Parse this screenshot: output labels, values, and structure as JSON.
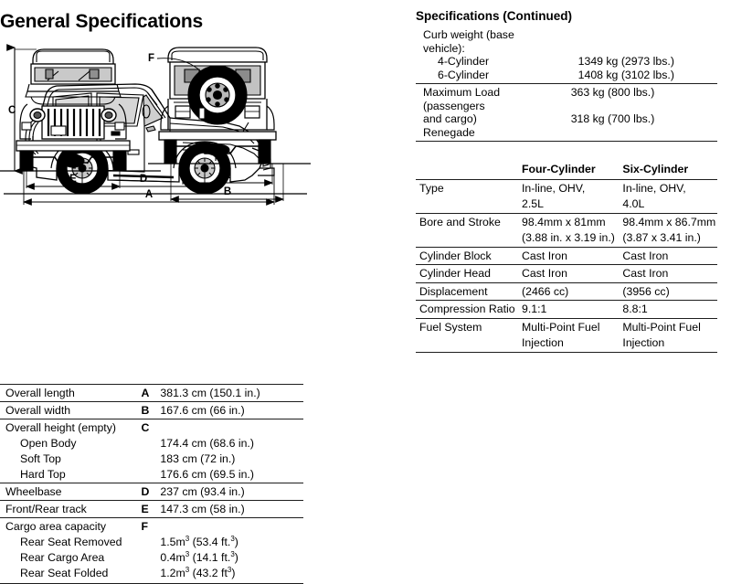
{
  "page": {
    "title": "General Specifications"
  },
  "illustration": {
    "views": [
      {
        "name": "side-view",
        "vehicle": "Jeep Wrangler YJ side profile"
      },
      {
        "name": "front-view",
        "vehicle": "Jeep Wrangler YJ front elevation"
      },
      {
        "name": "rear-view",
        "vehicle": "Jeep Wrangler YJ rear elevation with spare tire"
      }
    ],
    "dimension_callouts": [
      {
        "key": "A",
        "view": "side-view",
        "meaning": "Overall length"
      },
      {
        "key": "D",
        "view": "side-view",
        "meaning": "Wheelbase"
      },
      {
        "key": "C",
        "view": "front-view",
        "meaning": "Overall height"
      },
      {
        "key": "E",
        "view": "front-view",
        "meaning": "Front track"
      },
      {
        "key": "E",
        "view": "rear-view",
        "meaning": "Rear track"
      },
      {
        "key": "B",
        "view": "rear-view",
        "meaning": "Overall width"
      },
      {
        "key": "F",
        "view": "rear-view",
        "meaning": "Cargo area capacity"
      }
    ],
    "labels": {
      "A": "A",
      "B": "B",
      "C": "C",
      "D": "D",
      "E": "E",
      "F": "F"
    }
  },
  "specs_continued": {
    "title": "Specifications (Continued)",
    "weight_rows": [
      {
        "label": "Curb weight (base",
        "value": "",
        "indent": false
      },
      {
        "label": "vehicle):",
        "value": "",
        "indent": false
      },
      {
        "label": "4-Cylinder",
        "value": "1349 kg (2973 lbs.)",
        "indent": true
      },
      {
        "label": "6-Cylinder",
        "value": "1408 kg (3102 lbs.)",
        "indent": true
      }
    ],
    "load_rows": [
      {
        "label": "Maximum Load",
        "value": "363 kg (800 lbs.)",
        "indent": false
      },
      {
        "label": "(passengers",
        "value": "",
        "indent": false
      },
      {
        "label": "and cargo)",
        "value": "318 kg (700 lbs.)",
        "indent": false
      },
      {
        "label": "Renegade",
        "value": "",
        "indent": false
      }
    ]
  },
  "engine_table": {
    "headers": {
      "spec": "",
      "four": "Four-Cylinder",
      "six": "Six-Cylinder"
    },
    "rows": [
      {
        "spec": "Type",
        "four": "In-line, OHV,",
        "six": "In-line, OHV,"
      },
      {
        "spec": "",
        "four": "2.5L",
        "six": "4.0L"
      },
      {
        "spec": "Bore and Stroke",
        "four": "98.4mm x 81mm",
        "six": "98.4mm x 86.7mm"
      },
      {
        "spec": "",
        "four": "(3.88 in. x 3.19 in.)",
        "six": "(3.87 x 3.41 in.)"
      },
      {
        "spec": "Cylinder Block",
        "four": "Cast Iron",
        "six": "Cast Iron"
      },
      {
        "spec": "Cylinder Head",
        "four": "Cast Iron",
        "six": "Cast Iron"
      },
      {
        "spec": "Displacement",
        "four": "(2466 cc)",
        "six": "(3956 cc)"
      },
      {
        "spec": "Compression Ratio",
        "four": "9.1:1",
        "six": "8.8:1"
      },
      {
        "spec": "Fuel System",
        "four": "Multi-Point Fuel",
        "six": "Multi-Point Fuel"
      },
      {
        "spec": "",
        "four": "Injection",
        "six": "Injection"
      }
    ]
  },
  "dimensions_table": {
    "rows": [
      {
        "name": "Overall length",
        "key": "A",
        "value": "381.3 cm (150.1 in.)",
        "indent": false
      },
      {
        "name": "Overall width",
        "key": "B",
        "value": "167.6 cm (66 in.)",
        "indent": false
      },
      {
        "name": "Overall height (empty)",
        "key": "C",
        "value": "",
        "indent": false
      },
      {
        "name": "Open Body",
        "key": "",
        "value": "174.4 cm (68.6 in.)",
        "indent": true
      },
      {
        "name": "Soft Top",
        "key": "",
        "value": "183 cm (72 in.)",
        "indent": true
      },
      {
        "name": "Hard Top",
        "key": "",
        "value": "176.6 cm (69.5 in.)",
        "indent": true
      },
      {
        "name": "Wheelbase",
        "key": "D",
        "value": "237 cm (93.4 in.)",
        "indent": false
      },
      {
        "name": "Front/Rear track",
        "key": "E",
        "value": "147.3 cm (58 in.)",
        "indent": false
      },
      {
        "name": "Cargo area capacity",
        "key": "F",
        "value": "",
        "indent": false
      },
      {
        "name": "Rear Seat Removed",
        "key": "",
        "value": "1.5m3 (53.4 ft.3)",
        "indent": true
      },
      {
        "name": "Rear Cargo Area",
        "key": "",
        "value": "0.4m3 (14.1 ft.3)",
        "indent": true
      },
      {
        "name": "Rear Seat Folded",
        "key": "",
        "value": "1.2m3 (43.2 ft3)",
        "indent": true
      }
    ],
    "cargo_values_formatted": [
      {
        "base1": "1.5m",
        "sup1": "3",
        "mid": " (53.4 ft.",
        "sup2": "3",
        "end": ")"
      },
      {
        "base1": "0.4m",
        "sup1": "3",
        "mid": " (14.1 ft.",
        "sup2": "3",
        "end": ")"
      },
      {
        "base1": "1.2m",
        "sup1": "3",
        "mid": " (43.2 ft",
        "sup2": "3",
        "end": ")"
      }
    ]
  },
  "colors": {
    "ink": "#000000",
    "rule": "#1d1d1d",
    "paper": "#ffffff"
  }
}
